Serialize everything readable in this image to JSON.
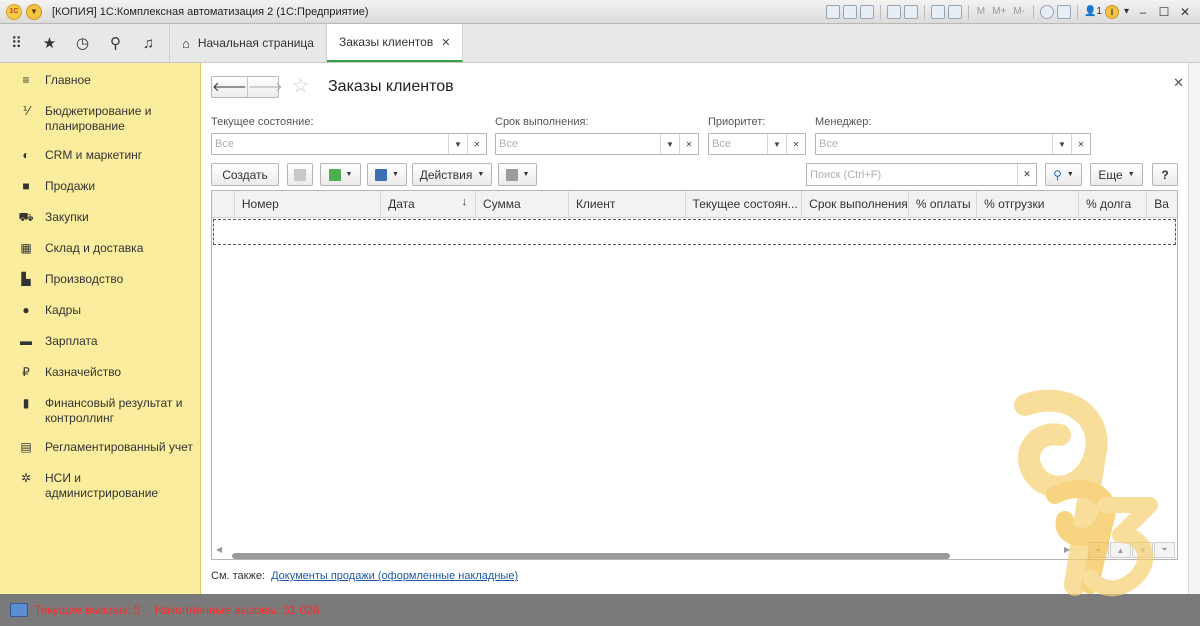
{
  "titlebar": {
    "title": "[КОПИЯ] 1С:Комплексная автоматизация 2  (1С:Предприятие)",
    "logo": "1С",
    "m_labels": [
      "M",
      "M+",
      "M-"
    ],
    "user_count": "1"
  },
  "tabs": {
    "home": "Начальная страница",
    "active": "Заказы клиентов"
  },
  "sidebar": {
    "items": [
      {
        "label": "Главное",
        "icon": "menu-icon"
      },
      {
        "label": "Бюджетирование и планирование",
        "icon": "budget-icon"
      },
      {
        "label": "CRM и маркетинг",
        "icon": "crm-icon"
      },
      {
        "label": "Продажи",
        "icon": "bag-icon"
      },
      {
        "label": "Закупки",
        "icon": "cart-icon"
      },
      {
        "label": "Склад и доставка",
        "icon": "warehouse-icon"
      },
      {
        "label": "Производство",
        "icon": "factory-icon"
      },
      {
        "label": "Кадры",
        "icon": "person-icon"
      },
      {
        "label": "Зарплата",
        "icon": "card-icon"
      },
      {
        "label": "Казначейство",
        "icon": "ruble-icon"
      },
      {
        "label": "Финансовый результат и контроллинг",
        "icon": "chart-icon"
      },
      {
        "label": "Регламентированный учет",
        "icon": "calculator-icon"
      },
      {
        "label": "НСИ и администрирование",
        "icon": "gear-icon"
      }
    ]
  },
  "form": {
    "title": "Заказы клиентов",
    "filters": [
      {
        "label": "Текущее состояние:",
        "placeholder": "Все"
      },
      {
        "label": "Срок выполнения:",
        "placeholder": "Все"
      },
      {
        "label": "Приоритет:",
        "placeholder": "Все"
      },
      {
        "label": "Менеджер:",
        "placeholder": "Все"
      }
    ],
    "toolbar": {
      "create": "Создать",
      "actions": "Действия",
      "search_placeholder": "Поиск (Ctrl+F)",
      "more": "Еще",
      "help": "?"
    },
    "columns": [
      "Номер",
      "Дата",
      "Сумма",
      "Клиент",
      "Текущее состоян...",
      "Срок выполнения",
      "% оплаты",
      "% отгрузки",
      "% долга",
      "Ва"
    ],
    "see_also_label": "См. также:",
    "see_also_link": "Документы продажи (оформленные накладные)"
  },
  "status": {
    "current_calls": "Текущие вызовы: 5",
    "accumulated_calls": "Накопленные вызовы: 31 026"
  },
  "colors": {
    "sidebar_bg": "#fbed9e",
    "active_tab_underline": "#36a04b",
    "status_text": "#ff2a2a",
    "link": "#1f5aa8"
  }
}
